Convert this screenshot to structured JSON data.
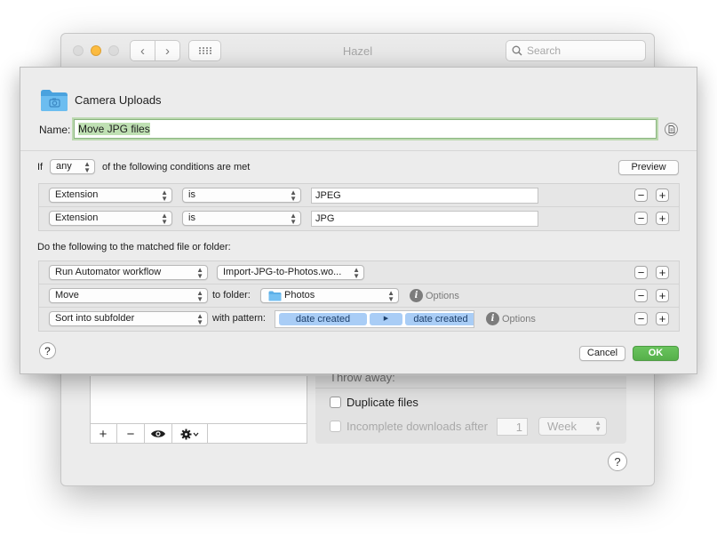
{
  "window": {
    "title": "Hazel",
    "search_placeholder": "Search",
    "back_glyph": "‹",
    "forward_glyph": "›"
  },
  "background": {
    "throw_away_label": "Throw away:",
    "duplicate_label": "Duplicate files",
    "incomplete_label": "Incomplete downloads after",
    "incomplete_value": "1",
    "incomplete_unit": "Week",
    "list_buttons": [
      "+",
      "−"
    ]
  },
  "sheet": {
    "folder_name": "Camera Uploads",
    "name_label": "Name:",
    "name_value": "Move JPG files",
    "if_label": "If",
    "match_mode": "any",
    "conditions_label": "of the following conditions are met",
    "preview_label": "Preview",
    "conditions": [
      {
        "attribute": "Extension",
        "operator": "is",
        "value": "JPEG"
      },
      {
        "attribute": "Extension",
        "operator": "is",
        "value": "JPG"
      }
    ],
    "actions_label": "Do the following to the matched file or folder:",
    "actions": [
      {
        "action": "Run Automator workflow",
        "target": "Import-JPG-to-Photos.wo..."
      },
      {
        "action": "Move",
        "connector": "to folder:",
        "folder": "Photos",
        "options": "Options"
      },
      {
        "action": "Sort into subfolder",
        "connector": "with pattern:",
        "tokens": [
          "date created",
          "date created"
        ],
        "options": "Options"
      }
    ],
    "cancel_label": "Cancel",
    "ok_label": "OK",
    "help_glyph": "?",
    "plus_glyph": "+",
    "minus_glyph": "−",
    "info_glyph": "i"
  },
  "colors": {
    "accent_green": "#56b04a",
    "token_blue": "#a9cdf6",
    "folder_blue": "#5cb0e8"
  }
}
